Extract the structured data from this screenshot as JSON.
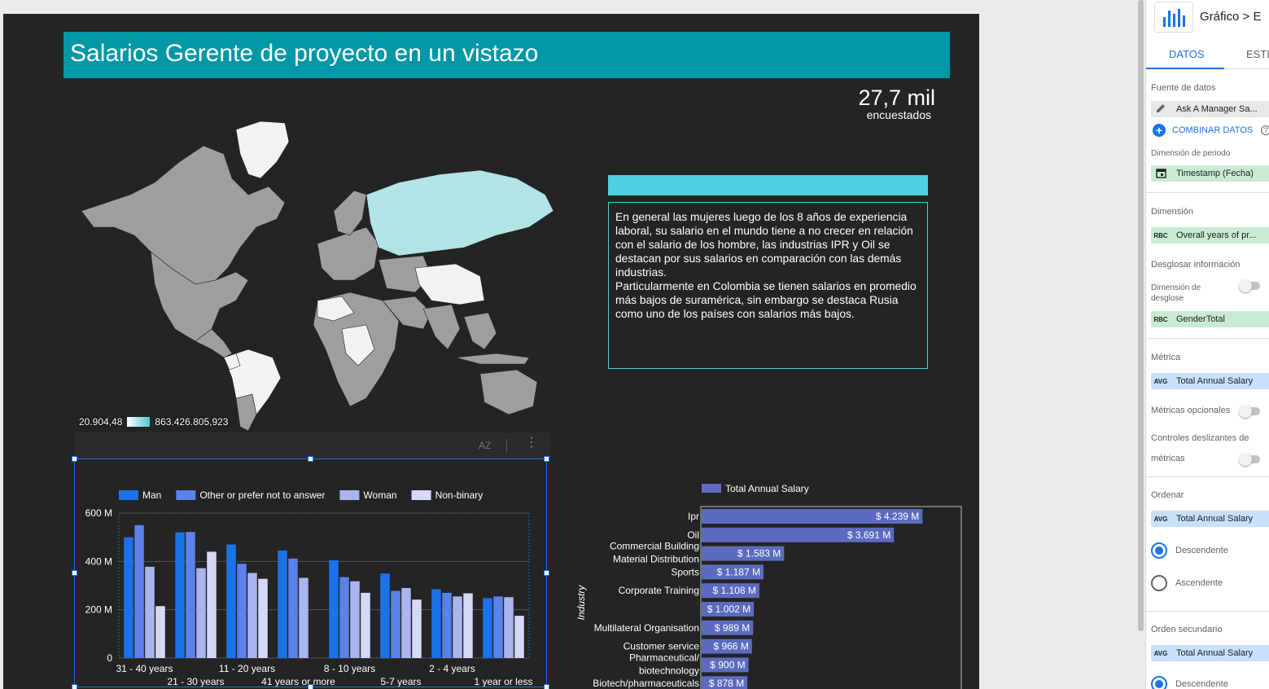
{
  "report": {
    "title": "Salarios Gerente de proyecto en un vistazo",
    "scorecard": {
      "value": "27,7 mil",
      "label": "encuestados"
    },
    "map_legend": {
      "min": "20.904,48",
      "max": "863.426.805,923"
    },
    "text_box": {
      "paragraph1": "En general las mujeres luego de los 8 años de experiencia laboral, su salario en el mundo tiene a no crecer en relación con el salario de los hombre, las industrias IPR y Oil se destacan por sus salarios en comparación con las demás industrias.",
      "paragraph2": "Particularmente en Colombia se tienen salarios en promedio más bajos de suramérica, sin embargo se destaca Rusia como uno de los países con salarios más bajos."
    },
    "toolbar": {
      "sort_icon_text": "AZ",
      "more_icon_text": "⋮"
    }
  },
  "colors": {
    "title_bg": "#0097a7",
    "accent": "#4dd0e1",
    "canvas_bg": "#242424",
    "selection": "#1a73e8",
    "map_low": "#ffffff",
    "map_high": "#b2e4e6",
    "map_nodata": "#9e9e9e"
  },
  "chart_data": [
    {
      "type": "bar",
      "categories": [
        "31 - 40 years",
        "21 - 30 years",
        "11 - 20 years",
        "41 years or more",
        "8 - 10 years",
        "5-7 years",
        "2 - 4 years",
        "1 year or less"
      ],
      "series": [
        {
          "name": "Man",
          "color": "#1a73e8",
          "values": [
            500,
            520,
            470,
            445,
            405,
            350,
            285,
            248
          ]
        },
        {
          "name": "Other or prefer not to answer",
          "color": "#5b82e8",
          "values": [
            550,
            522,
            390,
            412,
            335,
            278,
            270,
            255
          ]
        },
        {
          "name": "Woman",
          "color": "#aab5f0",
          "values": [
            378,
            372,
            352,
            332,
            318,
            290,
            255,
            252
          ]
        },
        {
          "name": "Non-binary",
          "color": "#d5d9f7",
          "values": [
            215,
            440,
            328,
            null,
            270,
            242,
            268,
            175
          ]
        }
      ],
      "yticks": [
        "0",
        "200 M",
        "400 M",
        "600 M"
      ],
      "ylim": [
        0,
        600
      ],
      "grid": true,
      "legend": "top"
    },
    {
      "type": "bar",
      "orientation": "horizontal",
      "series_name": "Total Annual Salary",
      "ylabel": "Industry",
      "categories": [
        "Ipr",
        "Oil",
        "Commercial Building",
        "Material Distribution",
        "Sports",
        "Corporate Training",
        "",
        "Multilateral Organisation",
        "Customer service",
        "Pharmaceutical/ biotechnology",
        "Biotech/pharmaceuticals"
      ],
      "values": [
        4239,
        3691,
        1583,
        1187,
        1108,
        1002,
        989,
        966,
        900,
        878
      ],
      "value_labels": [
        "$ 4.239 M",
        "$ 3.691 M",
        "$ 1.583 M",
        "$ 1.187 M",
        "$ 1.108 M",
        "$ 1.002 M",
        "$ 989 M",
        "$ 966 M",
        "$ 900 M",
        "$ 878 M"
      ],
      "bar_labels": [
        "Ipr",
        "Oil",
        "Commercial Building\nMaterial Distribution",
        "Sports",
        "Corporate Training",
        "",
        "Multilateral Organisation",
        "Customer service",
        "Pharmaceutical/\nbiotechnology",
        "Biotech/pharmaceuticals"
      ],
      "xlim": [
        0,
        5000
      ],
      "color": "#5c6bc0",
      "legend": "top"
    }
  ],
  "panel": {
    "header_title": "Gráfico > E",
    "tabs": [
      "DATOS",
      "ESTI"
    ],
    "data_source_label": "Fuente de datos",
    "data_source_value": "Ask A Manager Sa...",
    "combine_label": "COMBINAR DATOS",
    "period_label": "Dimensión de periodo",
    "period_value": "Timestamp (Fecha)",
    "dimension_label": "Dimensión",
    "dimension_value": "Overall years of pr...",
    "drilldown_label": "Desglosar información",
    "drilldown_dim_label": "Dimensión de desglose",
    "drilldown_value": "GenderTotal",
    "metric_label": "Métrica",
    "metric_value": "Total Annual Salary",
    "optional_metrics_label": "Métricas opcionales",
    "sliders_label_1": "Controles deslizantes de",
    "sliders_label_2": "métricas",
    "sort_label": "Ordenar",
    "sort_value": "Total Annual Salary",
    "desc_label": "Descendente",
    "asc_label": "Ascendente",
    "secondary_sort_label": "Orden secundario",
    "secondary_sort_value": "Total Annual Salary",
    "secondary_desc_label": "Descendente",
    "chip_icons": {
      "rbc": "RBC",
      "avg": "AVG"
    }
  }
}
